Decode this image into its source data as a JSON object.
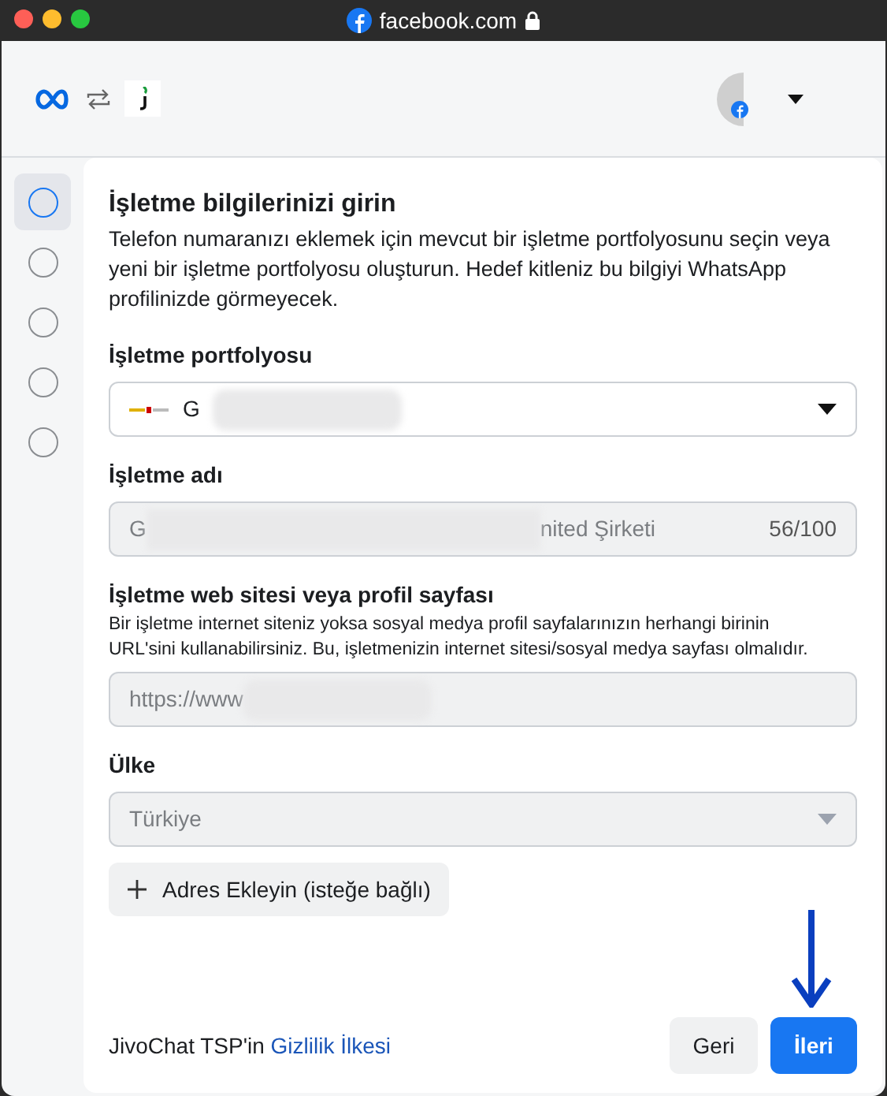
{
  "window": {
    "title": "facebook.com"
  },
  "steps": [
    {
      "selected": true
    },
    {
      "selected": false
    },
    {
      "selected": false
    },
    {
      "selected": false
    },
    {
      "selected": false
    }
  ],
  "form": {
    "title": "İşletme bilgilerinizi girin",
    "description": "Telefon numaranızı eklemek için mevcut bir işletme portfolyosunu seçin veya yeni bir işletme portfolyosu oluşturun. Hedef kitleniz bu bilgiyi WhatsApp profilinizde görmeyecek.",
    "fields": [
      {
        "kind": "select",
        "label": "İşletme portfolyosu",
        "value": "G",
        "disabled": false
      },
      {
        "kind": "text",
        "label": "İşletme adı",
        "value_start": "G",
        "value_end": "nited Şirketi",
        "counter": "56/100"
      },
      {
        "kind": "url",
        "label": "İşletme web sitesi veya profil sayfası",
        "help": "Bir işletme internet siteniz yoksa sosyal medya profil sayfalarınızın herhangi birinin URL'sini kullanabilirsiniz. Bu, işletmenizin internet sitesi/sosyal medya sayfası olmalıdır.",
        "value": "https://www"
      },
      {
        "kind": "select",
        "label": "Ülke",
        "value": "Türkiye",
        "disabled": true
      }
    ],
    "add_button": "Adres Ekleyin (isteğe bağlı)"
  },
  "footer": {
    "text": "JivoChat TSP'in",
    "link": "Gizlilik İlkesi",
    "buttons": [
      {
        "label": "Geri",
        "primary": false
      },
      {
        "label": "İleri",
        "primary": true
      }
    ]
  }
}
